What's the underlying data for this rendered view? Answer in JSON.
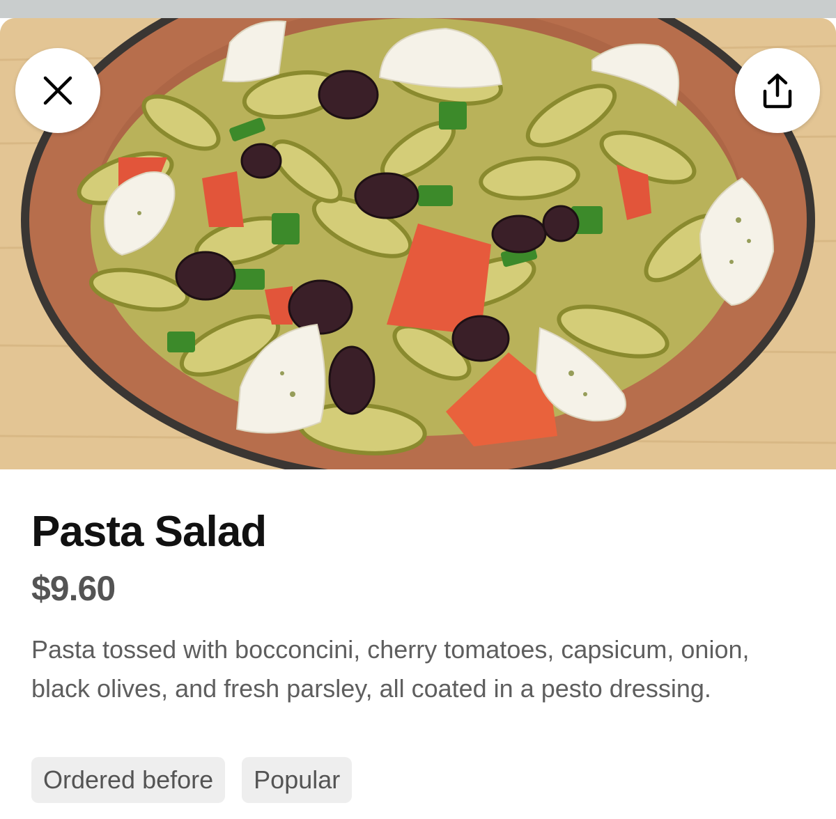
{
  "hero": {
    "image_name": "pasta-salad-photo",
    "close_icon": "close-icon",
    "share_icon": "share-icon"
  },
  "item": {
    "title": "Pasta Salad",
    "price": "$9.60",
    "description": "Pasta tossed with bocconcini, cherry tomatoes, capsicum, onion, black olives, and fresh parsley, all coated in a pesto dressing."
  },
  "tags": [
    {
      "label": "Ordered before"
    },
    {
      "label": "Popular"
    }
  ],
  "colors": {
    "title": "#111111",
    "price": "#545454",
    "description": "#5e5e5e",
    "tag_bg": "#eeeeee",
    "topbar": "#c9cdcd"
  }
}
